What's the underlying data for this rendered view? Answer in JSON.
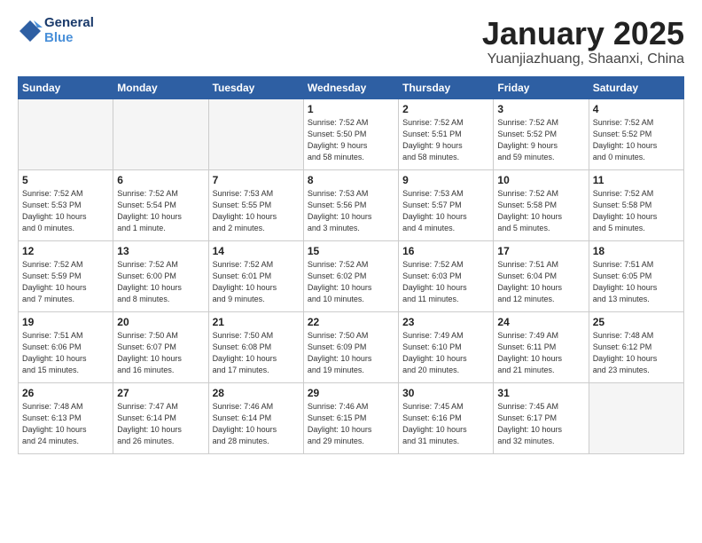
{
  "header": {
    "logo_text1": "General",
    "logo_text2": "Blue",
    "title": "January 2025",
    "subtitle": "Yuanjiazhuang, Shaanxi, China"
  },
  "weekdays": [
    "Sunday",
    "Monday",
    "Tuesday",
    "Wednesday",
    "Thursday",
    "Friday",
    "Saturday"
  ],
  "weeks": [
    [
      {
        "num": "",
        "info": "",
        "empty": true
      },
      {
        "num": "",
        "info": "",
        "empty": true
      },
      {
        "num": "",
        "info": "",
        "empty": true
      },
      {
        "num": "1",
        "info": "Sunrise: 7:52 AM\nSunset: 5:50 PM\nDaylight: 9 hours\nand 58 minutes.",
        "empty": false
      },
      {
        "num": "2",
        "info": "Sunrise: 7:52 AM\nSunset: 5:51 PM\nDaylight: 9 hours\nand 58 minutes.",
        "empty": false
      },
      {
        "num": "3",
        "info": "Sunrise: 7:52 AM\nSunset: 5:52 PM\nDaylight: 9 hours\nand 59 minutes.",
        "empty": false
      },
      {
        "num": "4",
        "info": "Sunrise: 7:52 AM\nSunset: 5:52 PM\nDaylight: 10 hours\nand 0 minutes.",
        "empty": false
      }
    ],
    [
      {
        "num": "5",
        "info": "Sunrise: 7:52 AM\nSunset: 5:53 PM\nDaylight: 10 hours\nand 0 minutes.",
        "empty": false
      },
      {
        "num": "6",
        "info": "Sunrise: 7:52 AM\nSunset: 5:54 PM\nDaylight: 10 hours\nand 1 minute.",
        "empty": false
      },
      {
        "num": "7",
        "info": "Sunrise: 7:53 AM\nSunset: 5:55 PM\nDaylight: 10 hours\nand 2 minutes.",
        "empty": false
      },
      {
        "num": "8",
        "info": "Sunrise: 7:53 AM\nSunset: 5:56 PM\nDaylight: 10 hours\nand 3 minutes.",
        "empty": false
      },
      {
        "num": "9",
        "info": "Sunrise: 7:53 AM\nSunset: 5:57 PM\nDaylight: 10 hours\nand 4 minutes.",
        "empty": false
      },
      {
        "num": "10",
        "info": "Sunrise: 7:52 AM\nSunset: 5:58 PM\nDaylight: 10 hours\nand 5 minutes.",
        "empty": false
      },
      {
        "num": "11",
        "info": "Sunrise: 7:52 AM\nSunset: 5:58 PM\nDaylight: 10 hours\nand 5 minutes.",
        "empty": false
      }
    ],
    [
      {
        "num": "12",
        "info": "Sunrise: 7:52 AM\nSunset: 5:59 PM\nDaylight: 10 hours\nand 7 minutes.",
        "empty": false
      },
      {
        "num": "13",
        "info": "Sunrise: 7:52 AM\nSunset: 6:00 PM\nDaylight: 10 hours\nand 8 minutes.",
        "empty": false
      },
      {
        "num": "14",
        "info": "Sunrise: 7:52 AM\nSunset: 6:01 PM\nDaylight: 10 hours\nand 9 minutes.",
        "empty": false
      },
      {
        "num": "15",
        "info": "Sunrise: 7:52 AM\nSunset: 6:02 PM\nDaylight: 10 hours\nand 10 minutes.",
        "empty": false
      },
      {
        "num": "16",
        "info": "Sunrise: 7:52 AM\nSunset: 6:03 PM\nDaylight: 10 hours\nand 11 minutes.",
        "empty": false
      },
      {
        "num": "17",
        "info": "Sunrise: 7:51 AM\nSunset: 6:04 PM\nDaylight: 10 hours\nand 12 minutes.",
        "empty": false
      },
      {
        "num": "18",
        "info": "Sunrise: 7:51 AM\nSunset: 6:05 PM\nDaylight: 10 hours\nand 13 minutes.",
        "empty": false
      }
    ],
    [
      {
        "num": "19",
        "info": "Sunrise: 7:51 AM\nSunset: 6:06 PM\nDaylight: 10 hours\nand 15 minutes.",
        "empty": false
      },
      {
        "num": "20",
        "info": "Sunrise: 7:50 AM\nSunset: 6:07 PM\nDaylight: 10 hours\nand 16 minutes.",
        "empty": false
      },
      {
        "num": "21",
        "info": "Sunrise: 7:50 AM\nSunset: 6:08 PM\nDaylight: 10 hours\nand 17 minutes.",
        "empty": false
      },
      {
        "num": "22",
        "info": "Sunrise: 7:50 AM\nSunset: 6:09 PM\nDaylight: 10 hours\nand 19 minutes.",
        "empty": false
      },
      {
        "num": "23",
        "info": "Sunrise: 7:49 AM\nSunset: 6:10 PM\nDaylight: 10 hours\nand 20 minutes.",
        "empty": false
      },
      {
        "num": "24",
        "info": "Sunrise: 7:49 AM\nSunset: 6:11 PM\nDaylight: 10 hours\nand 21 minutes.",
        "empty": false
      },
      {
        "num": "25",
        "info": "Sunrise: 7:48 AM\nSunset: 6:12 PM\nDaylight: 10 hours\nand 23 minutes.",
        "empty": false
      }
    ],
    [
      {
        "num": "26",
        "info": "Sunrise: 7:48 AM\nSunset: 6:13 PM\nDaylight: 10 hours\nand 24 minutes.",
        "empty": false
      },
      {
        "num": "27",
        "info": "Sunrise: 7:47 AM\nSunset: 6:14 PM\nDaylight: 10 hours\nand 26 minutes.",
        "empty": false
      },
      {
        "num": "28",
        "info": "Sunrise: 7:46 AM\nSunset: 6:14 PM\nDaylight: 10 hours\nand 28 minutes.",
        "empty": false
      },
      {
        "num": "29",
        "info": "Sunrise: 7:46 AM\nSunset: 6:15 PM\nDaylight: 10 hours\nand 29 minutes.",
        "empty": false
      },
      {
        "num": "30",
        "info": "Sunrise: 7:45 AM\nSunset: 6:16 PM\nDaylight: 10 hours\nand 31 minutes.",
        "empty": false
      },
      {
        "num": "31",
        "info": "Sunrise: 7:45 AM\nSunset: 6:17 PM\nDaylight: 10 hours\nand 32 minutes.",
        "empty": false
      },
      {
        "num": "",
        "info": "",
        "empty": true
      }
    ]
  ]
}
